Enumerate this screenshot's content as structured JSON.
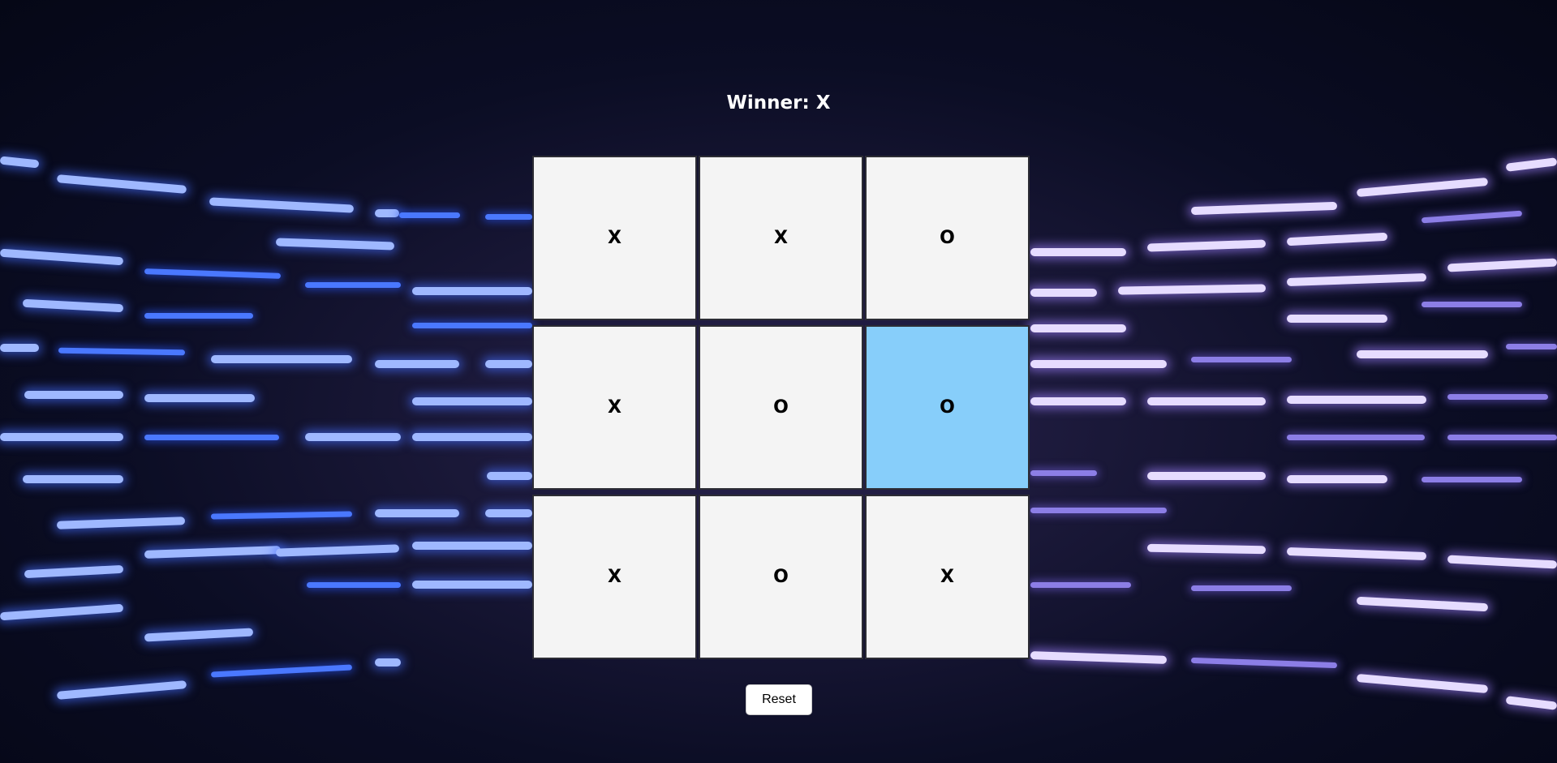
{
  "game": {
    "status_text": "Winner: X",
    "board": [
      {
        "mark": "X",
        "highlight": false
      },
      {
        "mark": "X",
        "highlight": false
      },
      {
        "mark": "O",
        "highlight": false
      },
      {
        "mark": "X",
        "highlight": false
      },
      {
        "mark": "O",
        "highlight": false
      },
      {
        "mark": "O",
        "highlight": true
      },
      {
        "mark": "X",
        "highlight": false
      },
      {
        "mark": "O",
        "highlight": false
      },
      {
        "mark": "X",
        "highlight": false
      }
    ],
    "reset_label": "Reset"
  },
  "colors": {
    "cell_background": "#f4f4f4",
    "highlight_cell": "#87cefa",
    "cell_border": "#2c2c34",
    "status_text": "#ffffff"
  }
}
